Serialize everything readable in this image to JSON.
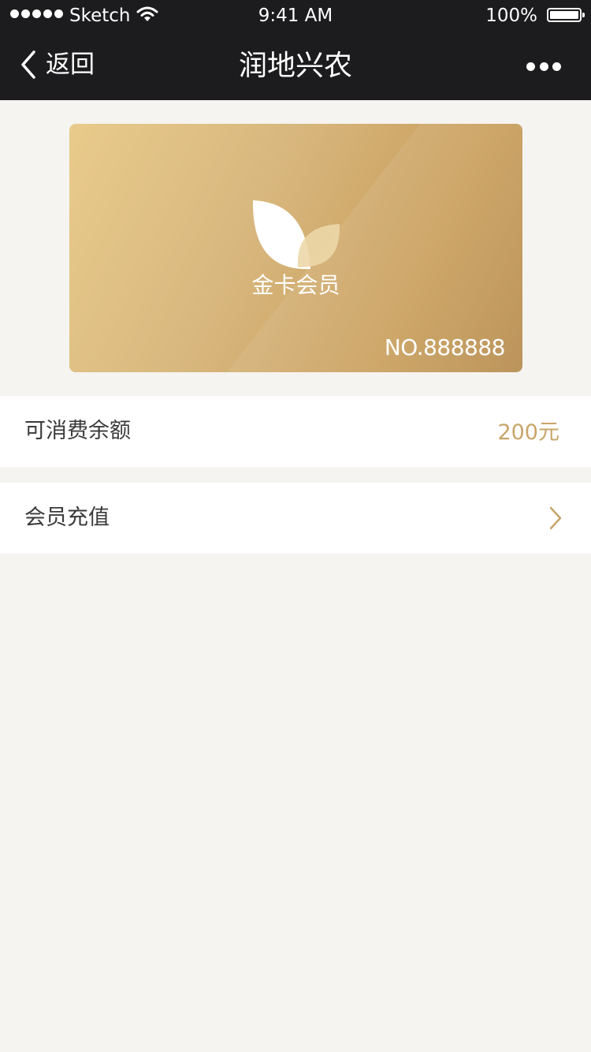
{
  "status_bar": {
    "carrier": "Sketch",
    "time": "9:41 AM",
    "battery": "100%",
    "signal_icon": "signal-dots-icon",
    "wifi_icon": "wifi-icon",
    "battery_icon": "battery-icon"
  },
  "nav": {
    "back_label": "返回",
    "title": "润地兴农",
    "back_icon": "chevron-left-icon",
    "more_icon": "more-dots-icon"
  },
  "card": {
    "tier": "金卡会员",
    "number": "NO.888888",
    "logo_icon": "leaf-logo-icon"
  },
  "balance": {
    "label": "可消费余额",
    "value": "200元"
  },
  "recharge": {
    "label": "会员充值",
    "icon": "chevron-right-icon"
  },
  "colors": {
    "nav_bg": "#1c1c1e",
    "page_bg": "#f5f4f1",
    "accent_gold": "#c9a469",
    "text": "#3a3a3a"
  }
}
